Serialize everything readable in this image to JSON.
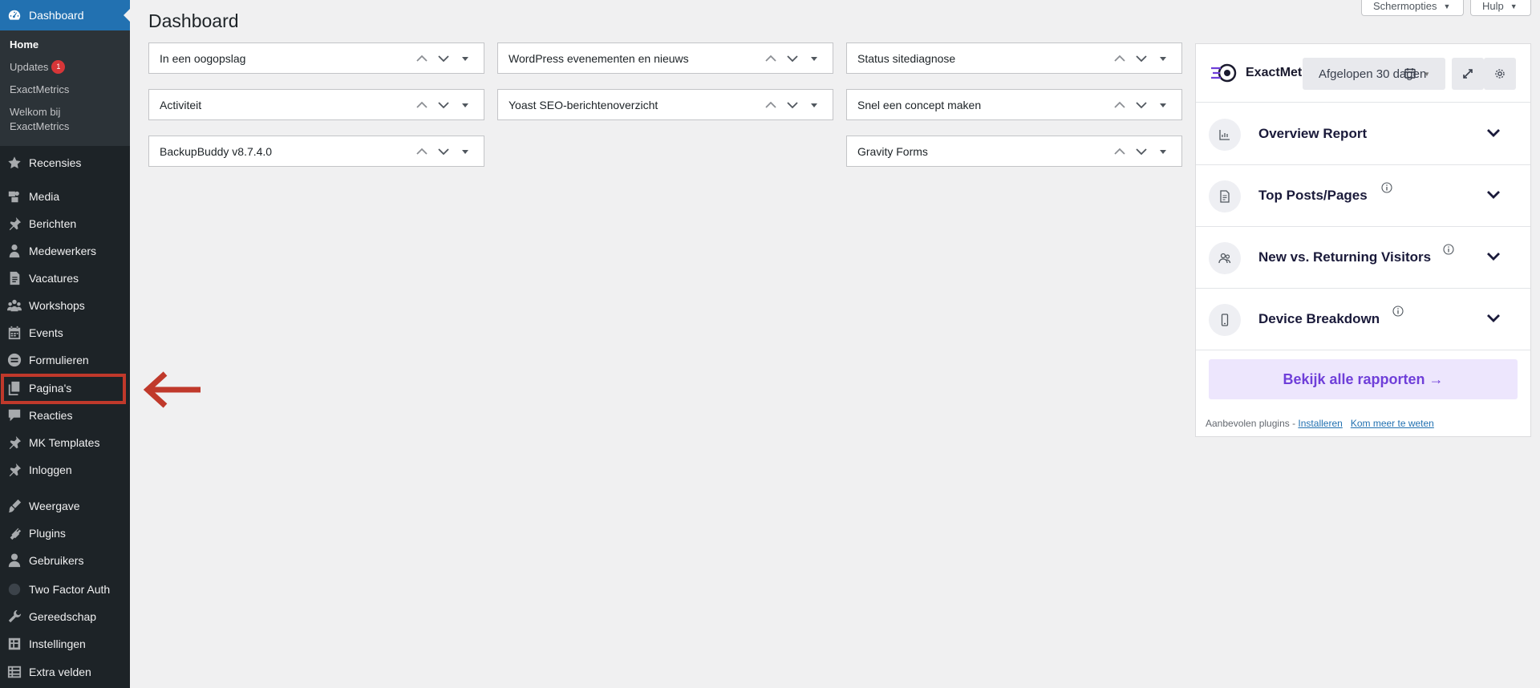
{
  "sidebar": {
    "dashboard_label": "Dashboard",
    "submenu": {
      "home": "Home",
      "updates": "Updates",
      "updates_count": "1",
      "exactmetrics": "ExactMetrics",
      "welkom": "Welkom bij ExactMetrics"
    },
    "items": [
      {
        "label": "Recensies",
        "icon": "star-icon"
      },
      {
        "label": "Media",
        "icon": "media-icon"
      },
      {
        "label": "Berichten",
        "icon": "pin-icon"
      },
      {
        "label": "Medewerkers",
        "icon": "person-icon"
      },
      {
        "label": "Vacatures",
        "icon": "document-icon"
      },
      {
        "label": "Workshops",
        "icon": "groups-icon"
      },
      {
        "label": "Events",
        "icon": "calendar-icon"
      },
      {
        "label": "Formulieren",
        "icon": "forms-icon"
      },
      {
        "label": "Pagina's",
        "icon": "pages-icon"
      },
      {
        "label": "Reacties",
        "icon": "comment-icon"
      },
      {
        "label": "MK Templates",
        "icon": "pin-icon"
      },
      {
        "label": "Inloggen",
        "icon": "pin-icon"
      },
      {
        "label": "Weergave",
        "icon": "brush-icon"
      },
      {
        "label": "Plugins",
        "icon": "plug-icon"
      },
      {
        "label": "Gebruikers",
        "icon": "user-icon"
      },
      {
        "label": "Two Factor Auth",
        "icon": "circle-icon"
      },
      {
        "label": "Gereedschap",
        "icon": "wrench-icon"
      },
      {
        "label": "Instellingen",
        "icon": "settings-icon"
      },
      {
        "label": "Extra velden",
        "icon": "table-icon"
      }
    ]
  },
  "header": {
    "title": "Dashboard",
    "screen_options": "Schermopties",
    "help": "Hulp"
  },
  "widgets": {
    "col1": [
      "In een oogopslag",
      "Activiteit",
      "BackupBuddy v8.7.4.0"
    ],
    "col2": [
      "WordPress evenementen en nieuws",
      "Yoast SEO-berichtenoverzicht"
    ],
    "col3": [
      "Status sitediagnose",
      "Snel een concept maken",
      "Gravity Forms"
    ]
  },
  "exactmetrics": {
    "brand": "ExactMet",
    "date_range": "Afgelopen 30 dagen",
    "reports": [
      {
        "title": "Overview Report",
        "icon": "chart-icon",
        "info": false
      },
      {
        "title": "Top Posts/Pages",
        "icon": "file-icon",
        "info": true
      },
      {
        "title": "New vs. Returning Visitors",
        "icon": "users-icon",
        "info": true
      },
      {
        "title": "Device Breakdown",
        "icon": "mobile-icon",
        "info": true
      }
    ],
    "cta": "Bekijk alle rapporten →",
    "footer_text": "Aanbevolen plugins - ",
    "install_link": "Installeren",
    "learn_more_link": "Kom meer te weten"
  },
  "colors": {
    "sidebar_bg": "#1d2327",
    "active_blue": "#2271b1",
    "highlight_red": "#c0392b",
    "cta_purple": "#6f3fd9"
  }
}
